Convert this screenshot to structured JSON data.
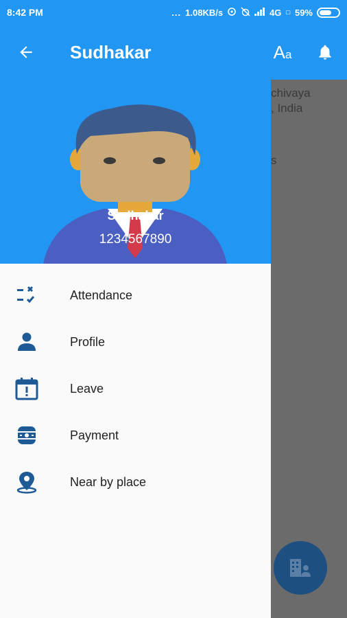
{
  "status_bar": {
    "time": "8:42 PM",
    "dots": "...",
    "speed": "1.08KB/s",
    "network": "4G",
    "battery": "59%"
  },
  "toolbar": {
    "title": "Sudhakar",
    "font_label_big": "A",
    "font_label_small": "a"
  },
  "background": {
    "line1": "chivaya",
    "line2": ", India",
    "line3": "s"
  },
  "drawer": {
    "header": {
      "name": "Sudhakar",
      "phone": "1234567890"
    },
    "items": [
      {
        "label": "Attendance",
        "icon": "attendance-icon"
      },
      {
        "label": "Profile",
        "icon": "person-icon"
      },
      {
        "label": "Leave",
        "icon": "calendar-alert-icon"
      },
      {
        "label": "Payment",
        "icon": "payment-icon"
      },
      {
        "label": "Near by place",
        "icon": "location-pin-icon"
      }
    ]
  },
  "colors": {
    "primary": "#2196f3",
    "icon_blue": "#1e5a96",
    "scrim": "#6b6b6b",
    "fab": "#1d4f80"
  }
}
